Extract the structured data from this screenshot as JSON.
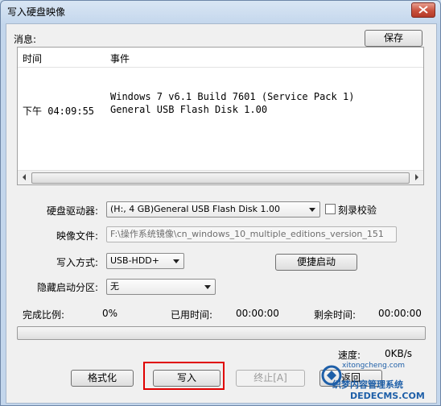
{
  "window": {
    "title": "写入硬盘映像"
  },
  "messages": {
    "label": "消息:",
    "save_button": "保存",
    "columns": [
      "时间",
      "事件"
    ],
    "rows": [
      {
        "time": "",
        "event": "Windows 7 v6.1 Build 7601 (Service Pack 1)"
      },
      {
        "time": "下午 04:09:55",
        "event": "General USB Flash Disk  1.00"
      }
    ]
  },
  "form": {
    "drive_label": "硬盘驱动器:",
    "drive_value": "(H:, 4 GB)General USB Flash Disk  1.00",
    "verify_label": "刻录校验",
    "image_label": "映像文件:",
    "image_value": "F:\\操作系统镜像\\cn_windows_10_multiple_editions_version_151",
    "write_mode_label": "写入方式:",
    "write_mode_value": "USB-HDD+",
    "quick_boot_button": "便捷启动",
    "hidden_partition_label": "隐藏启动分区:",
    "hidden_partition_value": "无"
  },
  "progress": {
    "completed_label": "完成比例:",
    "completed_value": "0%",
    "elapsed_label": "已用时间:",
    "elapsed_value": "00:00:00",
    "remaining_label": "剩余时间:",
    "remaining_value": "00:00:00",
    "speed_label": "速度:",
    "speed_value": "0KB/s",
    "fraction": 0
  },
  "buttons": {
    "format": "格式化",
    "write": "写入",
    "stop": "终止[A]",
    "back_partial": "返回"
  },
  "watermark": {
    "text1": "xitongcheng.com",
    "text2": "织梦内容管理系统",
    "text3": "DEDECMS.COM"
  },
  "colors": {
    "highlight": "#e00000",
    "title_bar": "#c3d6ec",
    "close": "#c8503c"
  }
}
